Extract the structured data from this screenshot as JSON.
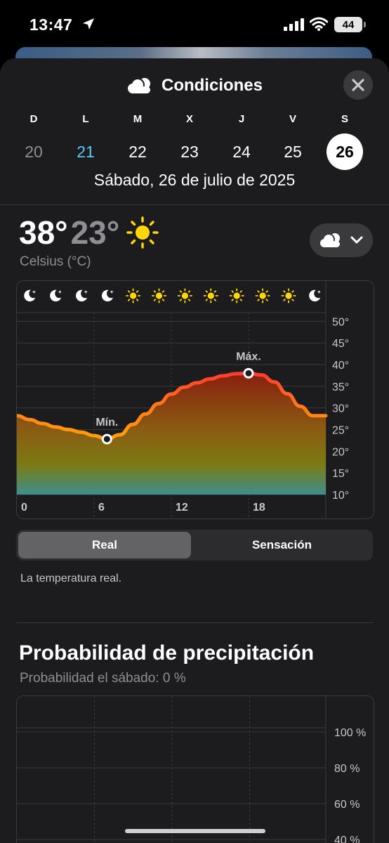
{
  "status_bar": {
    "time": "13:47",
    "battery": "44"
  },
  "sheet": {
    "title": "Condiciones",
    "icon": "cloud-icon",
    "close_icon": "close-icon"
  },
  "days": [
    {
      "name": "D",
      "num": "20",
      "state": "past"
    },
    {
      "name": "L",
      "num": "21",
      "state": "today"
    },
    {
      "name": "M",
      "num": "22",
      "state": "future"
    },
    {
      "name": "X",
      "num": "23",
      "state": "future"
    },
    {
      "name": "J",
      "num": "24",
      "state": "future"
    },
    {
      "name": "V",
      "num": "25",
      "state": "future"
    },
    {
      "name": "S",
      "num": "26",
      "state": "selected"
    }
  ],
  "full_date": "Sábado, 26 de julio de 2025",
  "temperature": {
    "high": "38°",
    "low": "23°",
    "unit_label": "Celsius (°C)",
    "icon": "sun-icon"
  },
  "condition_toggle": {
    "icon": "cloud-icon",
    "chevron": "chevron-down-icon"
  },
  "temp_chart": {
    "hour_icons": [
      "moon-star-icon",
      "moon-star-icon",
      "moon-star-icon",
      "moon-star-icon",
      "sun-icon",
      "sun-icon",
      "sun-icon",
      "sun-icon",
      "sun-icon",
      "sun-icon",
      "sun-icon",
      "moon-star-icon"
    ],
    "min_label": "Mín.",
    "max_label": "Máx."
  },
  "chart_data": {
    "type": "area",
    "x": [
      0,
      1,
      2,
      3,
      4,
      5,
      6,
      7,
      8,
      9,
      10,
      11,
      12,
      13,
      14,
      15,
      16,
      17,
      18,
      19,
      20,
      21,
      22,
      23
    ],
    "values": [
      28.2,
      27.3,
      26.4,
      25.6,
      25.0,
      24.4,
      23.6,
      22.8,
      23.8,
      26.2,
      28.6,
      31.0,
      33.2,
      34.8,
      35.8,
      36.7,
      37.4,
      37.9,
      38.0,
      37.6,
      36.0,
      33.3,
      30.4,
      28.2
    ],
    "min": {
      "x": 7,
      "y": 22.8
    },
    "max": {
      "x": 18,
      "y": 38.0
    },
    "xticks": [
      "0",
      "6",
      "12",
      "18"
    ],
    "yticks": [
      "50°",
      "45°",
      "40°",
      "35°",
      "30°",
      "25°",
      "20°",
      "15°",
      "10°"
    ],
    "ylim": [
      10,
      50
    ],
    "grid": true,
    "colors": {
      "line_low": "#ffa10a",
      "line_high": "#ff3b30",
      "fill_top": "#8a1f0f",
      "fill_bottom": "#3d8f8a"
    }
  },
  "segment": {
    "real": "Real",
    "feels": "Sensación",
    "selected": "real"
  },
  "segment_description": "La temperatura real.",
  "precipitation": {
    "title": "Probabilidad de precipitación",
    "subtitle": "Probabilidad el sábado: 0 %",
    "yticks": [
      "100 %",
      "80 %",
      "60 %",
      "40 %"
    ]
  }
}
